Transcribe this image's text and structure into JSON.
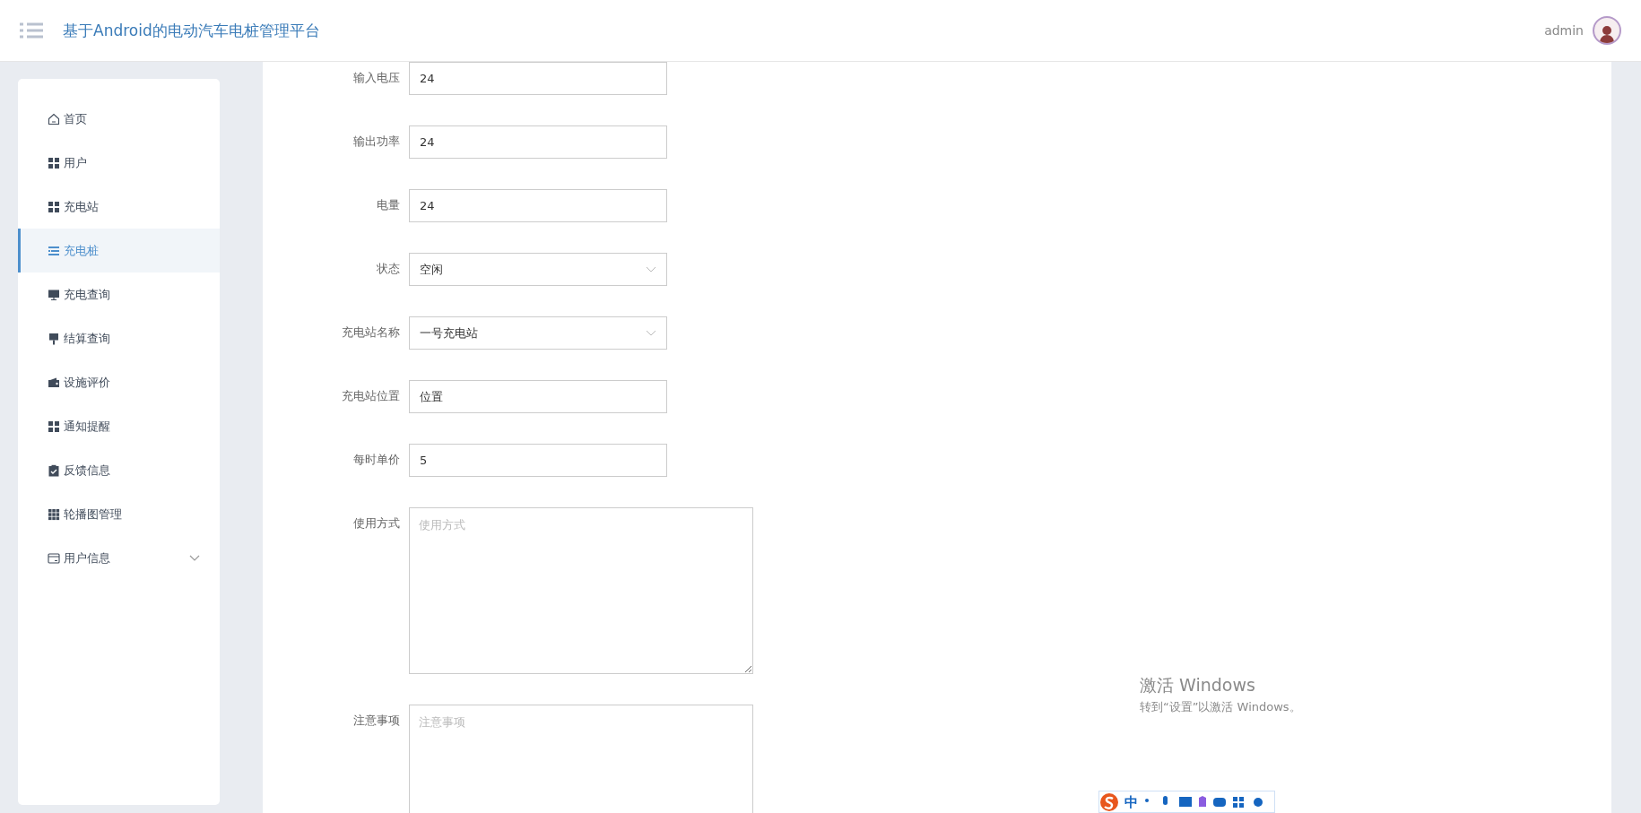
{
  "header": {
    "title": "基于Android的电动汽车电桩管理平台",
    "user": "admin"
  },
  "sidebar": {
    "items": [
      {
        "label": "首页",
        "selected": false
      },
      {
        "label": "用户",
        "selected": false
      },
      {
        "label": "充电站",
        "selected": false
      },
      {
        "label": "充电桩",
        "selected": true
      },
      {
        "label": "充电查询",
        "selected": false
      },
      {
        "label": "结算查询",
        "selected": false
      },
      {
        "label": "设施评价",
        "selected": false
      },
      {
        "label": "通知提醒",
        "selected": false
      },
      {
        "label": "反馈信息",
        "selected": false
      },
      {
        "label": "轮播图管理",
        "selected": false
      },
      {
        "label": "用户信息",
        "selected": false,
        "expanded": false
      }
    ]
  },
  "form": {
    "fields": [
      {
        "label": "输入电压",
        "kind": "input",
        "value": "24"
      },
      {
        "label": "输出功率",
        "kind": "input",
        "value": "24"
      },
      {
        "label": "电量",
        "kind": "input",
        "value": "24"
      },
      {
        "label": "状态",
        "kind": "select",
        "value": "空闲"
      },
      {
        "label": "充电站名称",
        "kind": "select",
        "value": "一号充电站"
      },
      {
        "label": "充电站位置",
        "kind": "input",
        "value": "位置"
      },
      {
        "label": "每时单价",
        "kind": "input",
        "value": "5"
      },
      {
        "label": "使用方式",
        "kind": "textarea",
        "placeholder": "使用方式"
      },
      {
        "label": "注意事项",
        "kind": "textarea",
        "placeholder": "注意事项"
      }
    ]
  },
  "ime_toolbar": {
    "mode": "中"
  },
  "activation_notice": {
    "title": "激活 Windows",
    "subtitle": "转到“设置”以激活 Windows。"
  }
}
